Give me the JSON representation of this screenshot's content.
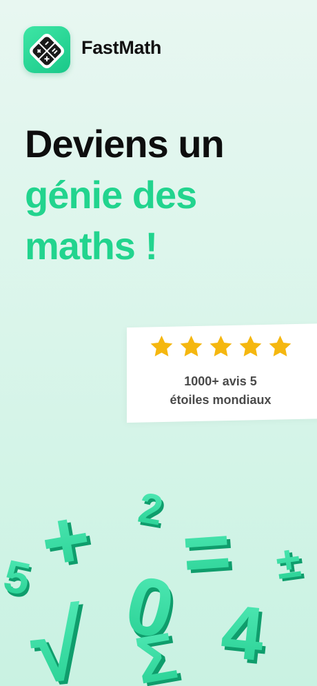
{
  "app": {
    "name": "FastMath",
    "icon": "calculator-logo-icon",
    "accent_color": "#22d48e"
  },
  "headline": {
    "line1": "Deviens un",
    "line2": "génie des",
    "line3": "maths !"
  },
  "rating": {
    "stars": 5,
    "star_color": "#f5b70f",
    "line1": "1000+ avis 5",
    "line2": "étoiles mondiaux"
  },
  "decor": {
    "symbols": [
      "5",
      "+",
      "2",
      "√",
      "0",
      "Σ",
      "=",
      "4",
      "±"
    ]
  }
}
